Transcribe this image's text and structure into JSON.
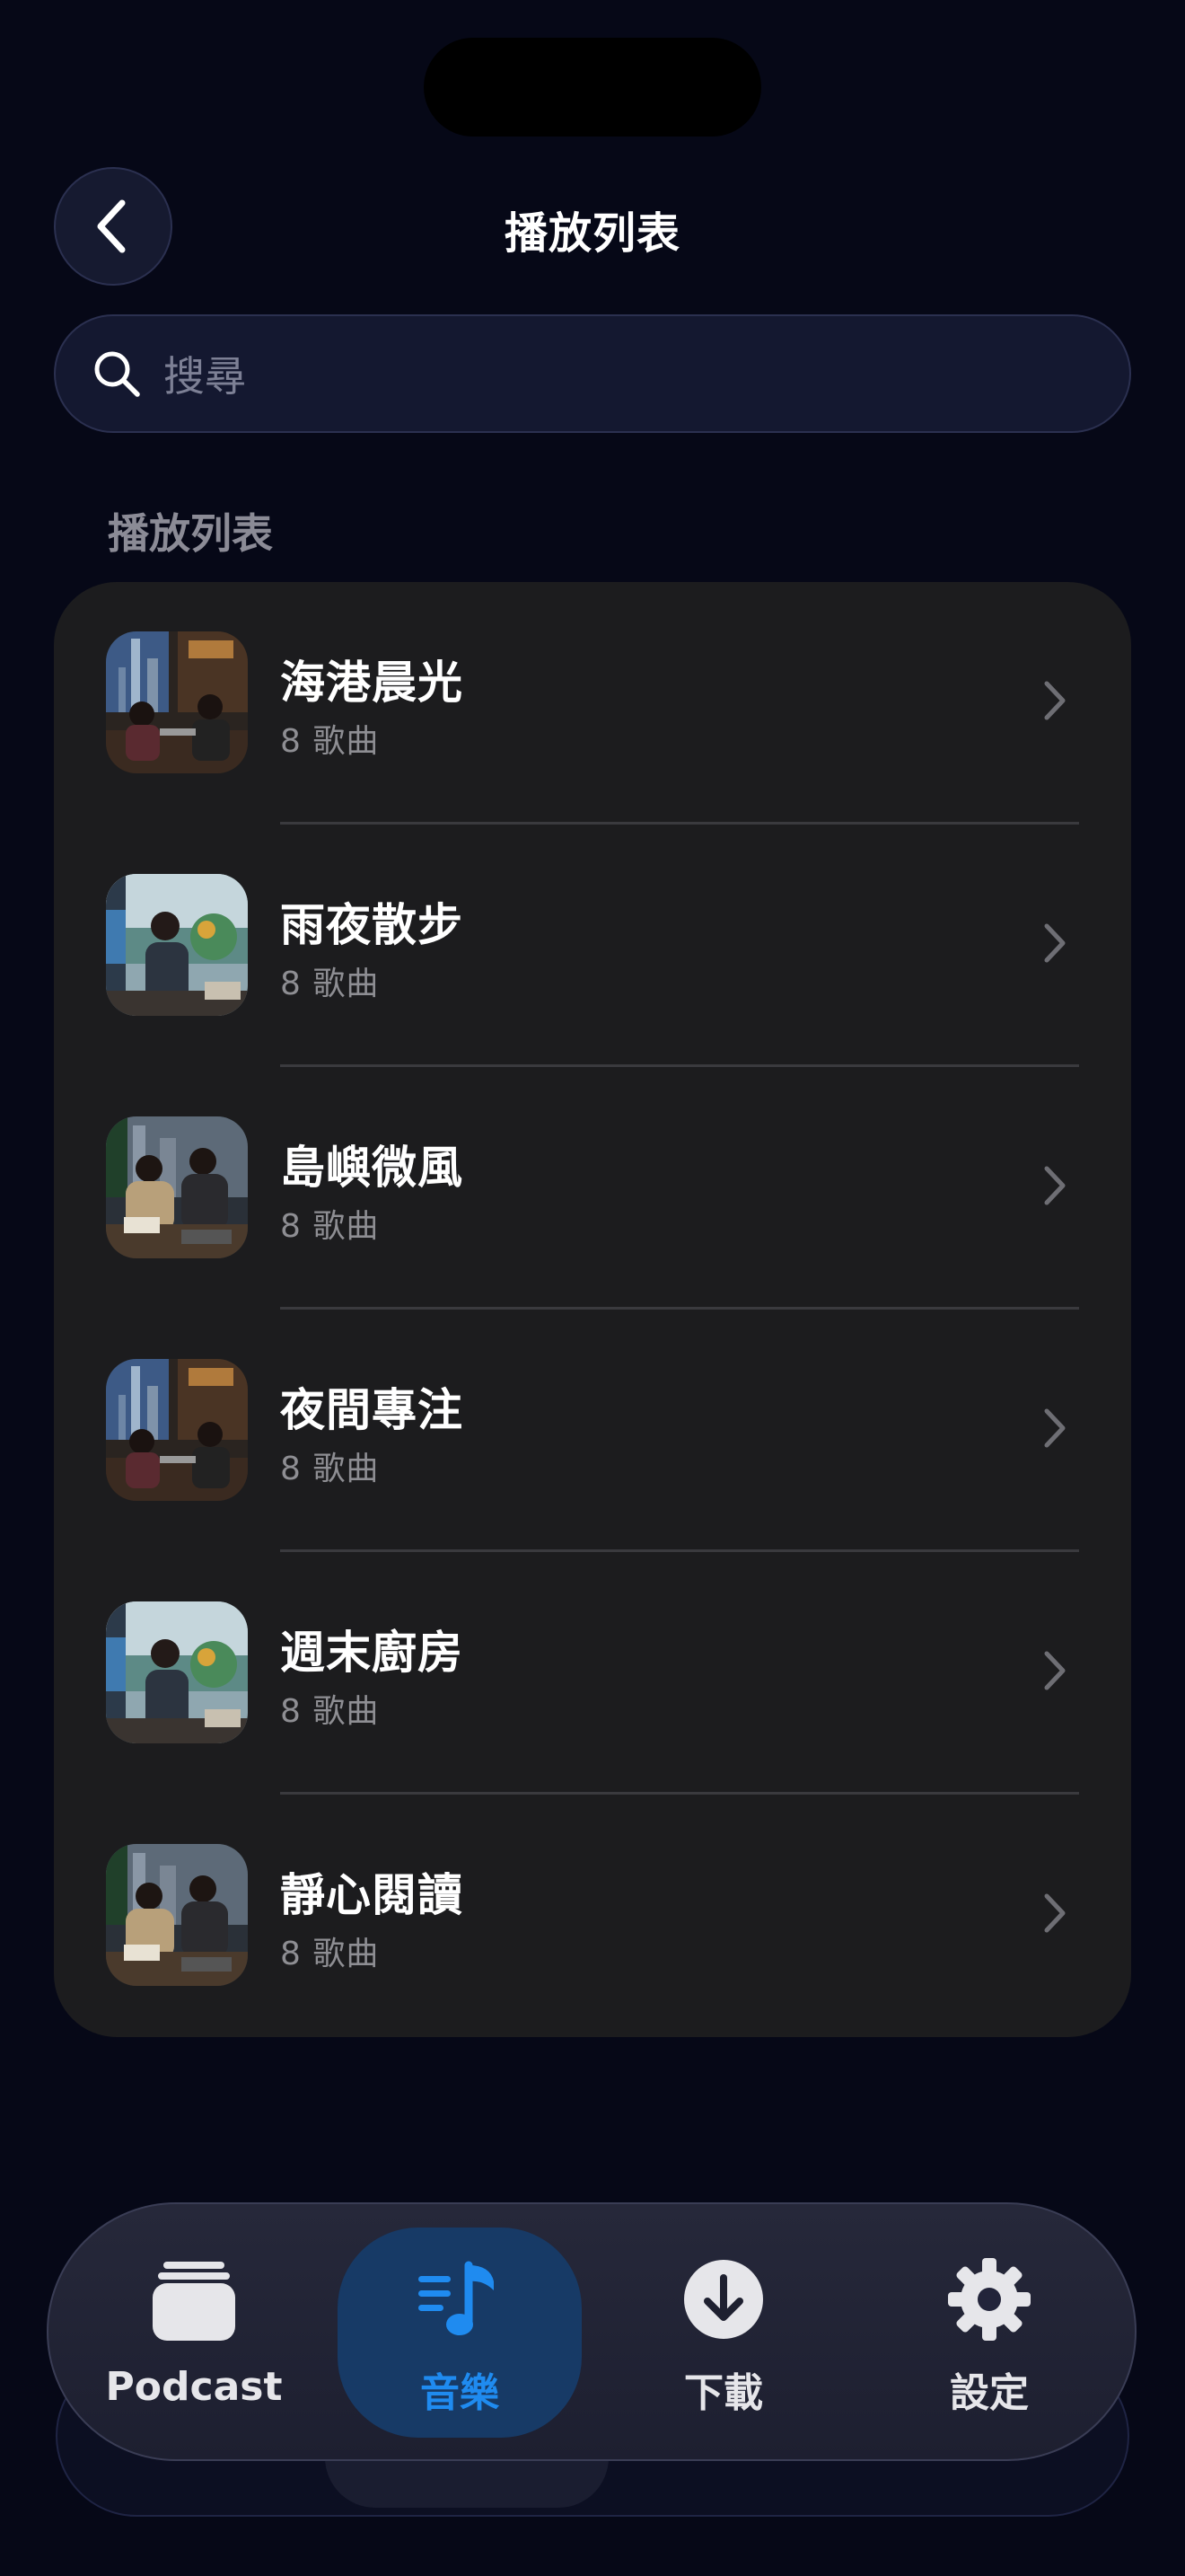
{
  "header": {
    "title": "播放列表",
    "back_icon": "chevron-left-icon"
  },
  "search": {
    "placeholder": "搜尋",
    "icon": "search-icon"
  },
  "section": {
    "label": "播放列表"
  },
  "playlists": [
    {
      "title": "海港晨光",
      "subtitle": "8 歌曲"
    },
    {
      "title": "雨夜散步",
      "subtitle": "8 歌曲"
    },
    {
      "title": "島嶼微風",
      "subtitle": "8 歌曲"
    },
    {
      "title": "夜間專注",
      "subtitle": "8 歌曲"
    },
    {
      "title": "週末廚房",
      "subtitle": "8 歌曲"
    },
    {
      "title": "靜心閱讀",
      "subtitle": "8 歌曲"
    }
  ],
  "tabs": [
    {
      "label": "Podcast",
      "icon": "podcast-stack-icon",
      "active": false
    },
    {
      "label": "音樂",
      "icon": "music-note-icon",
      "active": true
    },
    {
      "label": "下載",
      "icon": "download-icon",
      "active": false
    },
    {
      "label": "設定",
      "icon": "gear-icon",
      "active": false
    }
  ],
  "colors": {
    "background": "#060817",
    "card": "#1c1c1e",
    "accent": "#1f8bf0",
    "active_tab_bg": "#173a66"
  }
}
